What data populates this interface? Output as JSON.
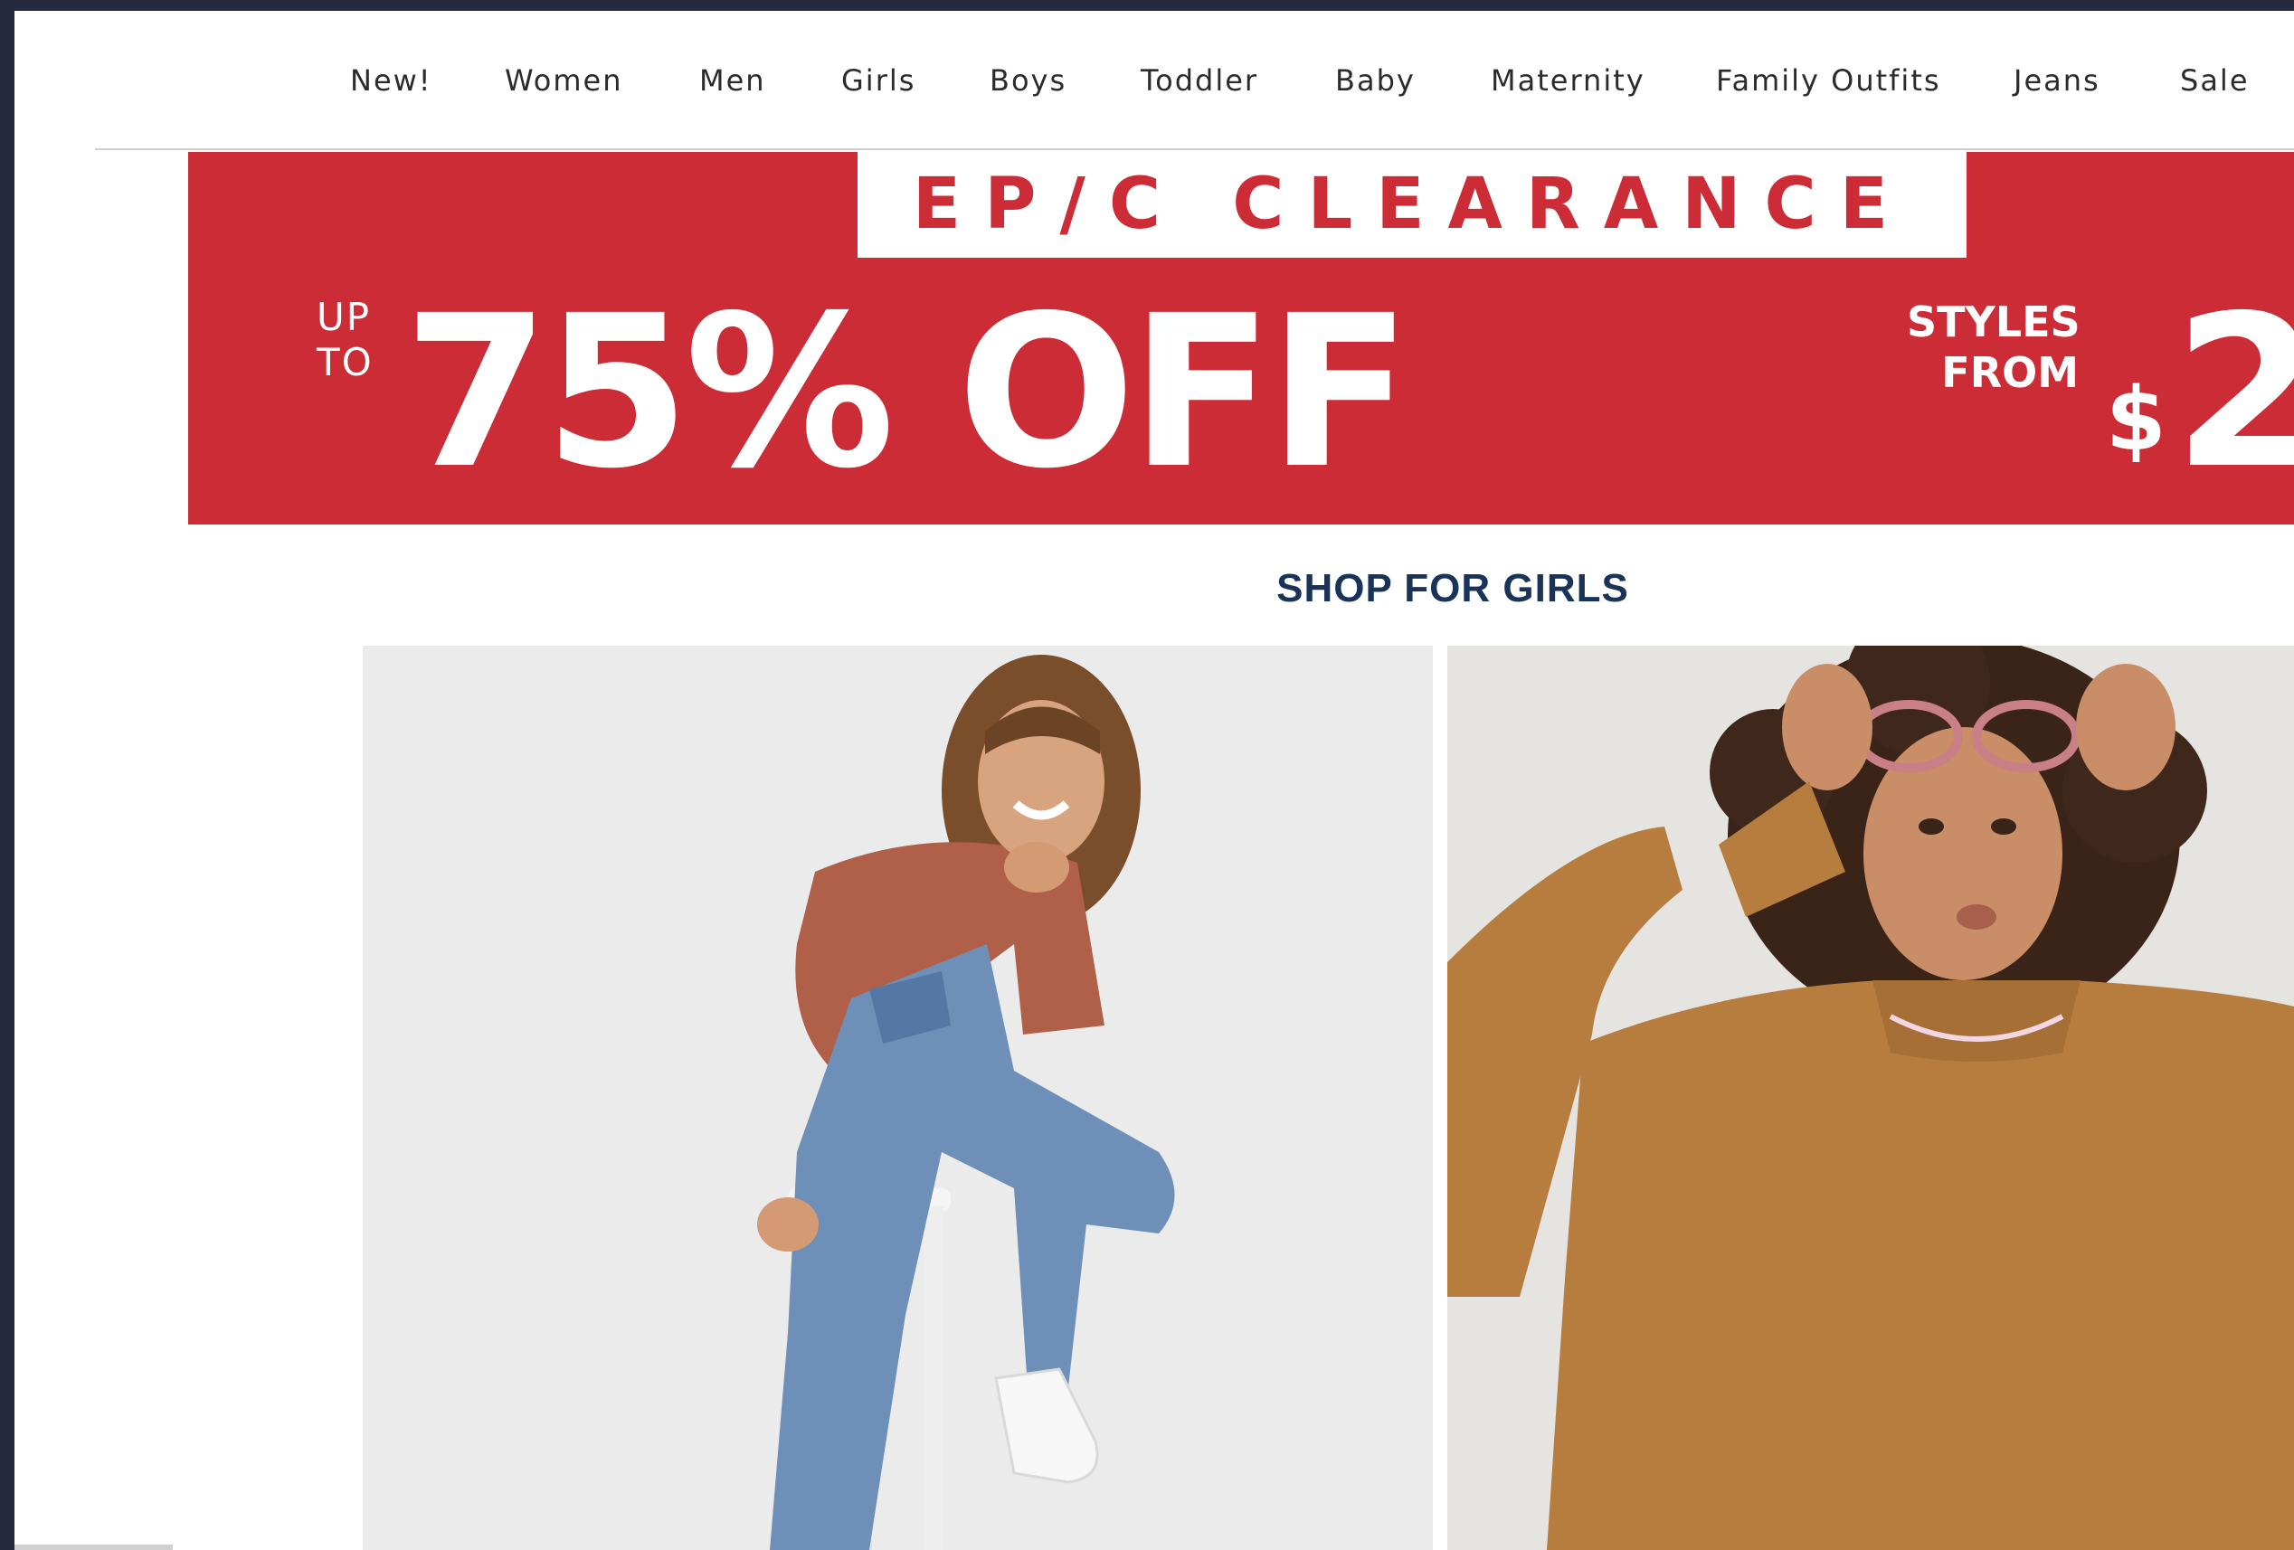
{
  "nav": {
    "items": [
      "New!",
      "Women",
      "Men",
      "Girls",
      "Boys",
      "Toddler",
      "Baby",
      "Maternity",
      "Family Outfits",
      "Jeans",
      "Sale"
    ]
  },
  "banner": {
    "clearance": "EP/C CLEARANCE",
    "up": "UP",
    "to": "TO",
    "offer": "75% OFF",
    "styles": "STYLES",
    "from": "FROM",
    "dollar": "$",
    "price_partial": "2",
    "bg_color": "#cc2c36"
  },
  "section": {
    "title": "SHOP FOR GIRLS"
  },
  "colors": {
    "frame": "#262a3f",
    "title": "#1a3358"
  }
}
